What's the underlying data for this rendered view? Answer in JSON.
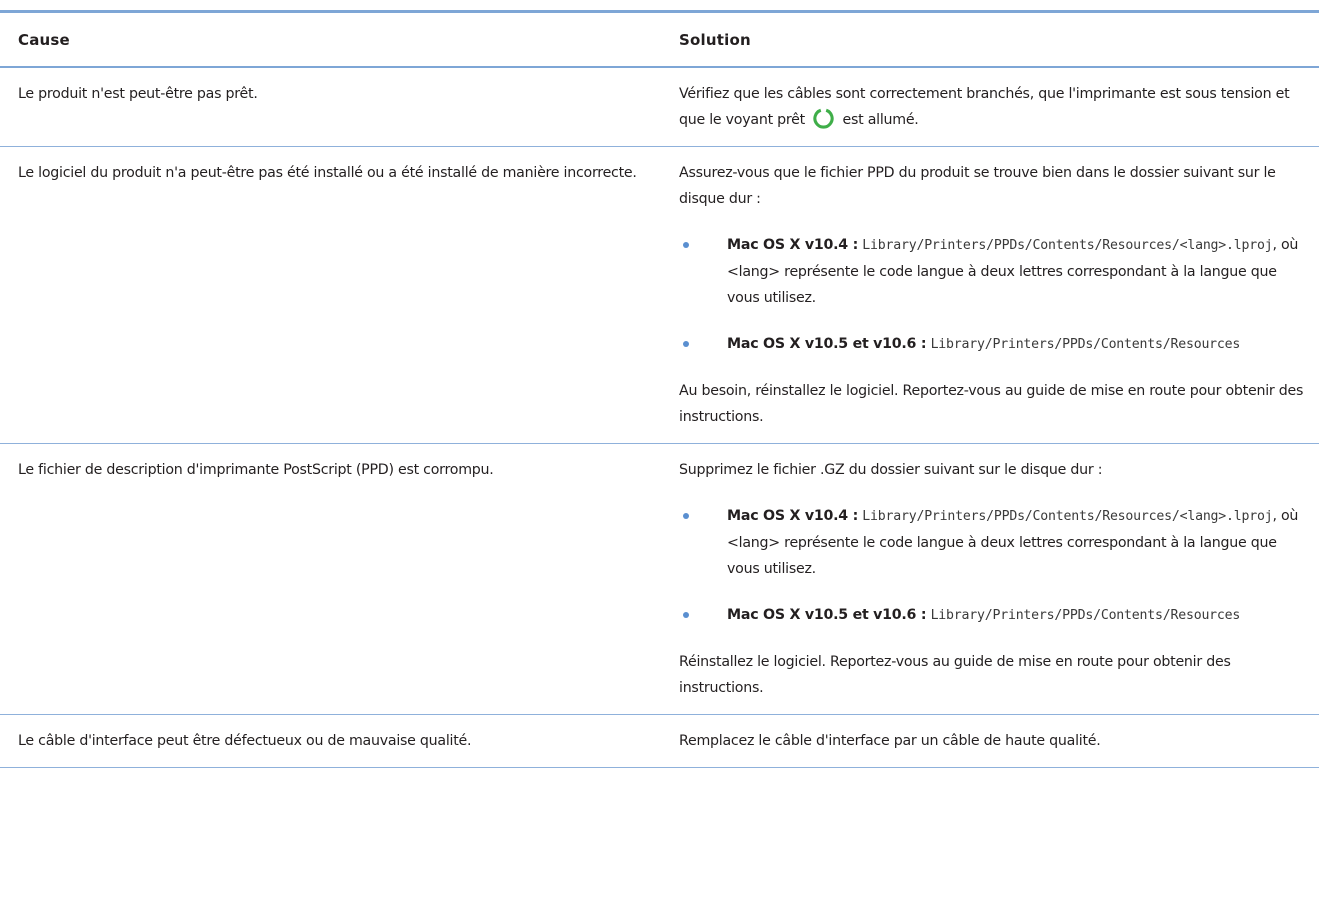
{
  "header": {
    "cause": "Cause",
    "solution": "Solution"
  },
  "rows": [
    {
      "cause": "Le produit n'est peut-être pas prêt.",
      "solution_before": "Vérifiez que les câbles sont correctement branchés, que l'imprimante est sous tension et que le voyant prêt",
      "solution_after": "est allumé."
    },
    {
      "cause": "Le logiciel du produit n'a peut-être pas été installé ou a été installé de manière incorrecte.",
      "intro": "Assurez-vous que le fichier PPD du produit se trouve bien dans le dossier suivant sur le disque dur :",
      "items": [
        {
          "label": "Mac OS X v10.4 :",
          "path": "Library/Printers/PPDs/Contents/Resources/<lang>.lproj",
          "rest": ", où <lang> représente le code langue à deux lettres correspondant à la langue que vous utilisez."
        },
        {
          "label": "Mac OS X v10.5 et v10.6 :",
          "path": "Library/Printers/PPDs/Contents/Resources",
          "rest": ""
        }
      ],
      "outro": "Au besoin, réinstallez le logiciel. Reportez-vous au guide de mise en route pour obtenir des instructions."
    },
    {
      "cause": "Le fichier de description d'imprimante PostScript (PPD) est corrompu.",
      "intro": "Supprimez le fichier .GZ du dossier suivant sur le disque dur :",
      "items": [
        {
          "label": "Mac OS X v10.4 :",
          "path": "Library/Printers/PPDs/Contents/Resources/<lang>.lproj",
          "rest": ", où <lang> représente le code langue à deux lettres correspondant à la langue que vous utilisez."
        },
        {
          "label": "Mac OS X v10.5 et v10.6 :",
          "path": "Library/Printers/PPDs/Contents/Resources",
          "rest": ""
        }
      ],
      "outro": "Réinstallez le logiciel. Reportez-vous au guide de mise en route pour obtenir des instructions."
    },
    {
      "cause": "Le câble d'interface peut être défectueux ou de mauvaise qualité.",
      "solution": "Remplacez le câble d'interface par un câble de haute qualité."
    }
  ],
  "icons": {
    "ready_light": "ready-light-icon",
    "ready_light_color": "#3fae49",
    "bullet_color": "#5a8fd0",
    "rule_color": "#7ea6d6"
  }
}
